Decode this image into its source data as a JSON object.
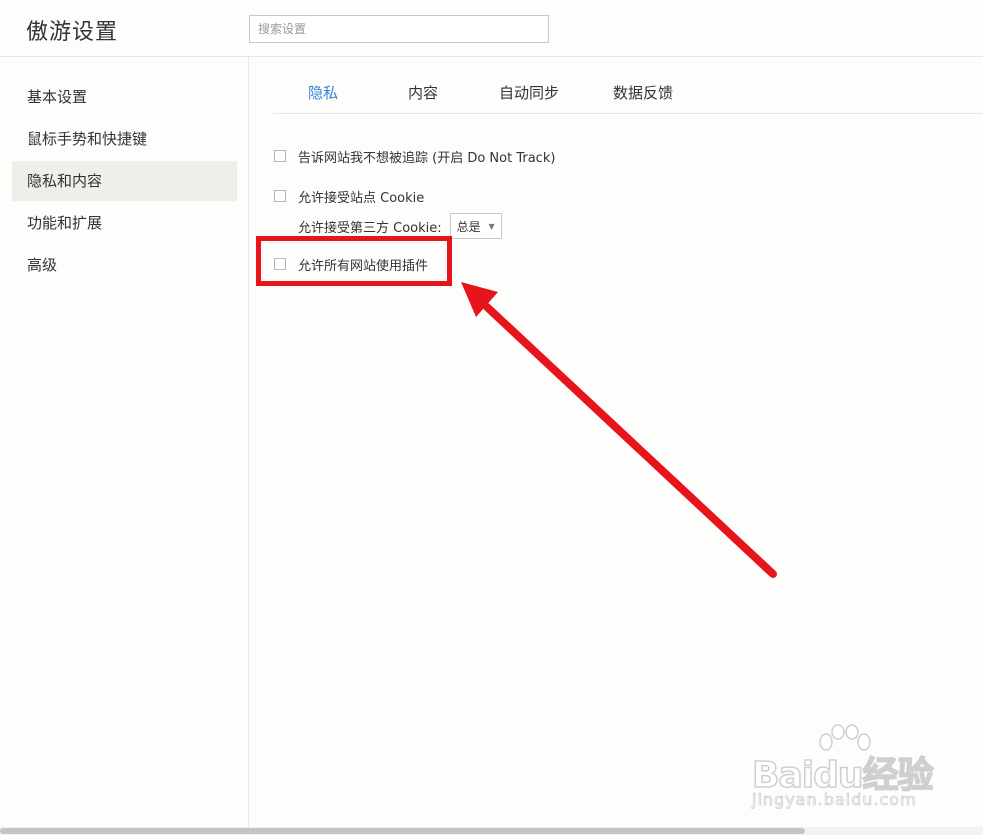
{
  "header": {
    "title": "傲游设置",
    "search_placeholder": "搜索设置"
  },
  "sidebar": {
    "items": [
      {
        "label": "基本设置"
      },
      {
        "label": "鼠标手势和快捷键"
      },
      {
        "label": "隐私和内容",
        "active": true
      },
      {
        "label": "功能和扩展"
      },
      {
        "label": "高级"
      }
    ]
  },
  "tabs": [
    {
      "label": "隐私",
      "active": true
    },
    {
      "label": "内容"
    },
    {
      "label": "自动同步"
    },
    {
      "label": "数据反馈"
    }
  ],
  "options": {
    "do_not_track": {
      "label": "告诉网站我不想被追踪 (开启 Do Not Track)",
      "checked": false
    },
    "accept_cookie": {
      "label": "允许接受站点 Cookie",
      "checked": false
    },
    "third_party_cookie": {
      "label": "允许接受第三方 Cookie:",
      "selected": "总是"
    },
    "allow_plugins": {
      "label": "允许所有网站使用插件",
      "checked": false
    }
  },
  "annotation": {
    "color": "#e8141c"
  },
  "colors": {
    "accent": "#3b82d8",
    "annotation": "#e8141c"
  },
  "watermark": {
    "brand": "Baidu经验",
    "sub": "jingyan.baidu.com"
  }
}
